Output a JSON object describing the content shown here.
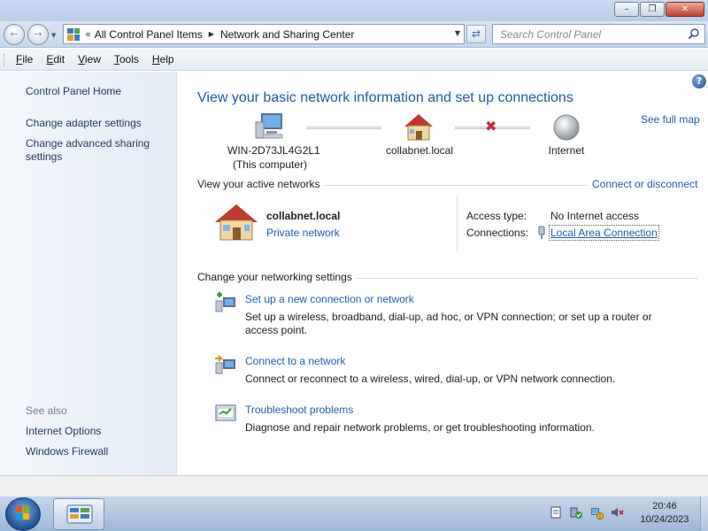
{
  "window": {
    "buttons": {
      "minimize": "–",
      "maximize": "❐",
      "close": "✕"
    }
  },
  "nav": {
    "back_glyph": "←",
    "forward_glyph": "→",
    "address": {
      "chevrons": "«",
      "crumbs": [
        "All Control Panel Items",
        "Network and Sharing Center"
      ],
      "crumb_separator": "▶"
    },
    "refresh_glyph": "⇄",
    "search_placeholder": "Search Control Panel"
  },
  "menubar": {
    "items": [
      {
        "hotkey": "F",
        "rest": "ile"
      },
      {
        "hotkey": "E",
        "rest": "dit"
      },
      {
        "hotkey": "V",
        "rest": "iew"
      },
      {
        "hotkey": "T",
        "rest": "ools"
      },
      {
        "hotkey": "H",
        "rest": "elp"
      }
    ]
  },
  "sidebar": {
    "home": "Control Panel Home",
    "links": [
      "Change adapter settings",
      "Change advanced sharing settings"
    ],
    "see_also_heading": "See also",
    "see_also": [
      "Internet Options",
      "Windows Firewall"
    ]
  },
  "main": {
    "help_glyph": "?",
    "title": "View your basic network information and set up connections",
    "see_full_map": "See full map",
    "map": {
      "computer_name": "WIN-2D73JL4G2L1",
      "computer_sub": "(This computer)",
      "network_name": "collabnet.local",
      "internet": "Internet",
      "broken_link": "✖"
    },
    "active_networks": {
      "heading": "View your active networks",
      "action": "Connect or disconnect",
      "network_name": "collabnet.local",
      "network_type": "Private network",
      "access_type_label": "Access type:",
      "access_type_value": "No Internet access",
      "connections_label": "Connections:",
      "connections_value": "Local Area Connection"
    },
    "change_settings": {
      "heading": "Change your networking settings",
      "tasks": [
        {
          "link": "Set up a new connection or network",
          "desc": "Set up a wireless, broadband, dial-up, ad hoc, or VPN connection; or set up a router or access point."
        },
        {
          "link": "Connect to a network",
          "desc": "Connect or reconnect to a wireless, wired, dial-up, or VPN network connection."
        },
        {
          "link": "Troubleshoot problems",
          "desc": "Diagnose and repair network problems, or get troubleshooting information."
        }
      ]
    }
  },
  "taskbar": {
    "clock_time": "20:46",
    "clock_date": "10/24/2023"
  },
  "colors": {
    "link": "#1c5ea8",
    "title": "#1e5aa6",
    "sidebar_link": "#1e395b",
    "error_x": "#d0282c"
  }
}
